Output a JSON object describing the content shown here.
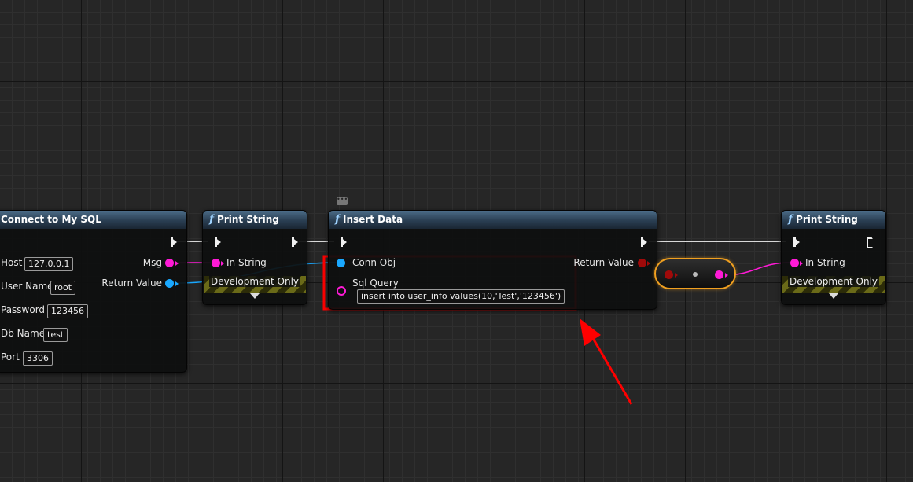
{
  "nodes": {
    "connect": {
      "title": "Connect to My SQL",
      "inputs": [
        {
          "label": "Host",
          "value": "127.0.0.1"
        },
        {
          "label": "User Name",
          "value": "root"
        },
        {
          "label": "Password",
          "value": "123456"
        },
        {
          "label": "Db Name",
          "value": "test"
        },
        {
          "label": "Port",
          "value": "3306"
        }
      ],
      "outputs": [
        {
          "label": "Msg"
        },
        {
          "label": "Return Value"
        }
      ]
    },
    "print1": {
      "title": "Print String",
      "in_string": "In String",
      "dev_only": "Development Only"
    },
    "insert": {
      "title": "Insert Data",
      "conn_obj": "Conn Obj",
      "sql_query": "Sql Query",
      "sql_value": "insert into user_info values(10,'Test','123456')",
      "return_value": "Return Value"
    },
    "print2": {
      "title": "Print String",
      "in_string": "In String",
      "dev_only": "Development Only"
    }
  },
  "colors": {
    "exec": "#f0f0f0",
    "string_pin": "#ff1ad6",
    "object_pin": "#1aa8ff",
    "byte_pin": "#a00a0a",
    "highlight": "#ff0000",
    "node_header": "#3c5a78",
    "reroute_border": "#f0a020"
  },
  "icons": {
    "function": "function-f-icon",
    "comment": "comment-bubble-icon",
    "exec": "exec-pin-icon"
  }
}
